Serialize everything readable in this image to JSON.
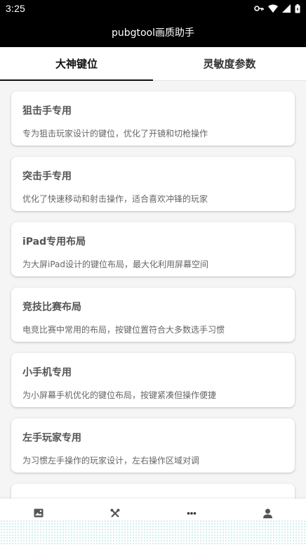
{
  "status": {
    "time": "3:25"
  },
  "app": {
    "title": "pubgtool画质助手"
  },
  "tabs": [
    {
      "label": "大神键位",
      "active": true
    },
    {
      "label": "灵敏度参数",
      "active": false
    }
  ],
  "cards": [
    {
      "title": "狙击手专用",
      "desc": "专为狙击玩家设计的键位，优化了开镜和切枪操作"
    },
    {
      "title": "突击手专用",
      "desc": "优化了快速移动和射击操作，适合喜欢冲锋的玩家"
    },
    {
      "title": "iPad专用布局",
      "desc": "为大屏iPad设计的键位布局，最大化利用屏幕空间"
    },
    {
      "title": "竞技比赛布局",
      "desc": "电竞比赛中常用的布局，按键位置符合大多数选手习惯"
    },
    {
      "title": "小手机专用",
      "desc": "为小屏幕手机优化的键位布局，按键紧凑但操作便捷"
    },
    {
      "title": "左手玩家专用",
      "desc": "为习惯左手操作的玩家设计，左右操作区域对调"
    }
  ],
  "bottom_nav": [
    {
      "icon": "image-icon"
    },
    {
      "icon": "tools-icon"
    },
    {
      "icon": "more-icon"
    },
    {
      "icon": "person-icon"
    }
  ]
}
